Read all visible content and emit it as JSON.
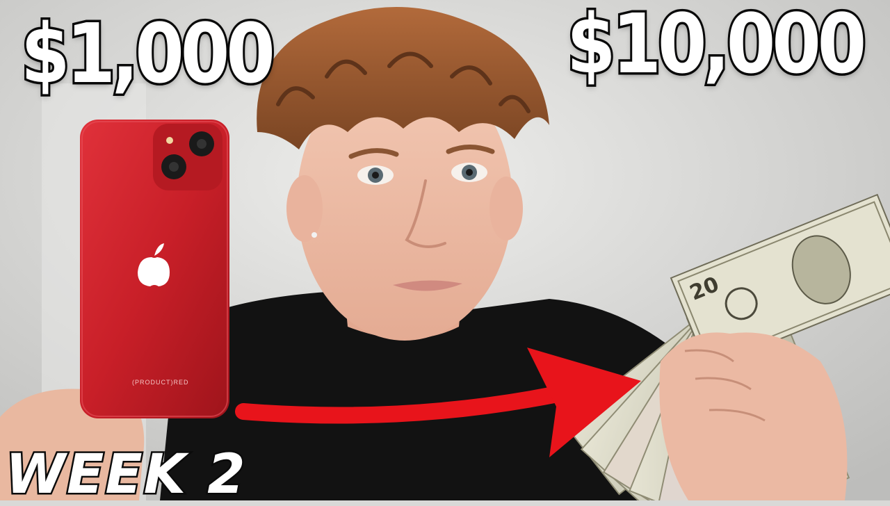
{
  "thumbnail": {
    "left_amount": "$1,000",
    "right_amount": "$10,000",
    "week_label": "WEEK 2",
    "phone_brand_mark": "(PRODUCT)RED"
  },
  "colors": {
    "background": "#d9d9d7",
    "phone": "#c81f28",
    "arrow": "#e8141b",
    "shirt": "#121212",
    "banknote": "#d8d6c4",
    "text_fill": "#ffffff",
    "text_outline": "#0b0b0b"
  },
  "icons": {
    "phone_logo": "apple-logo-icon",
    "arrow": "right-arrow-icon"
  }
}
